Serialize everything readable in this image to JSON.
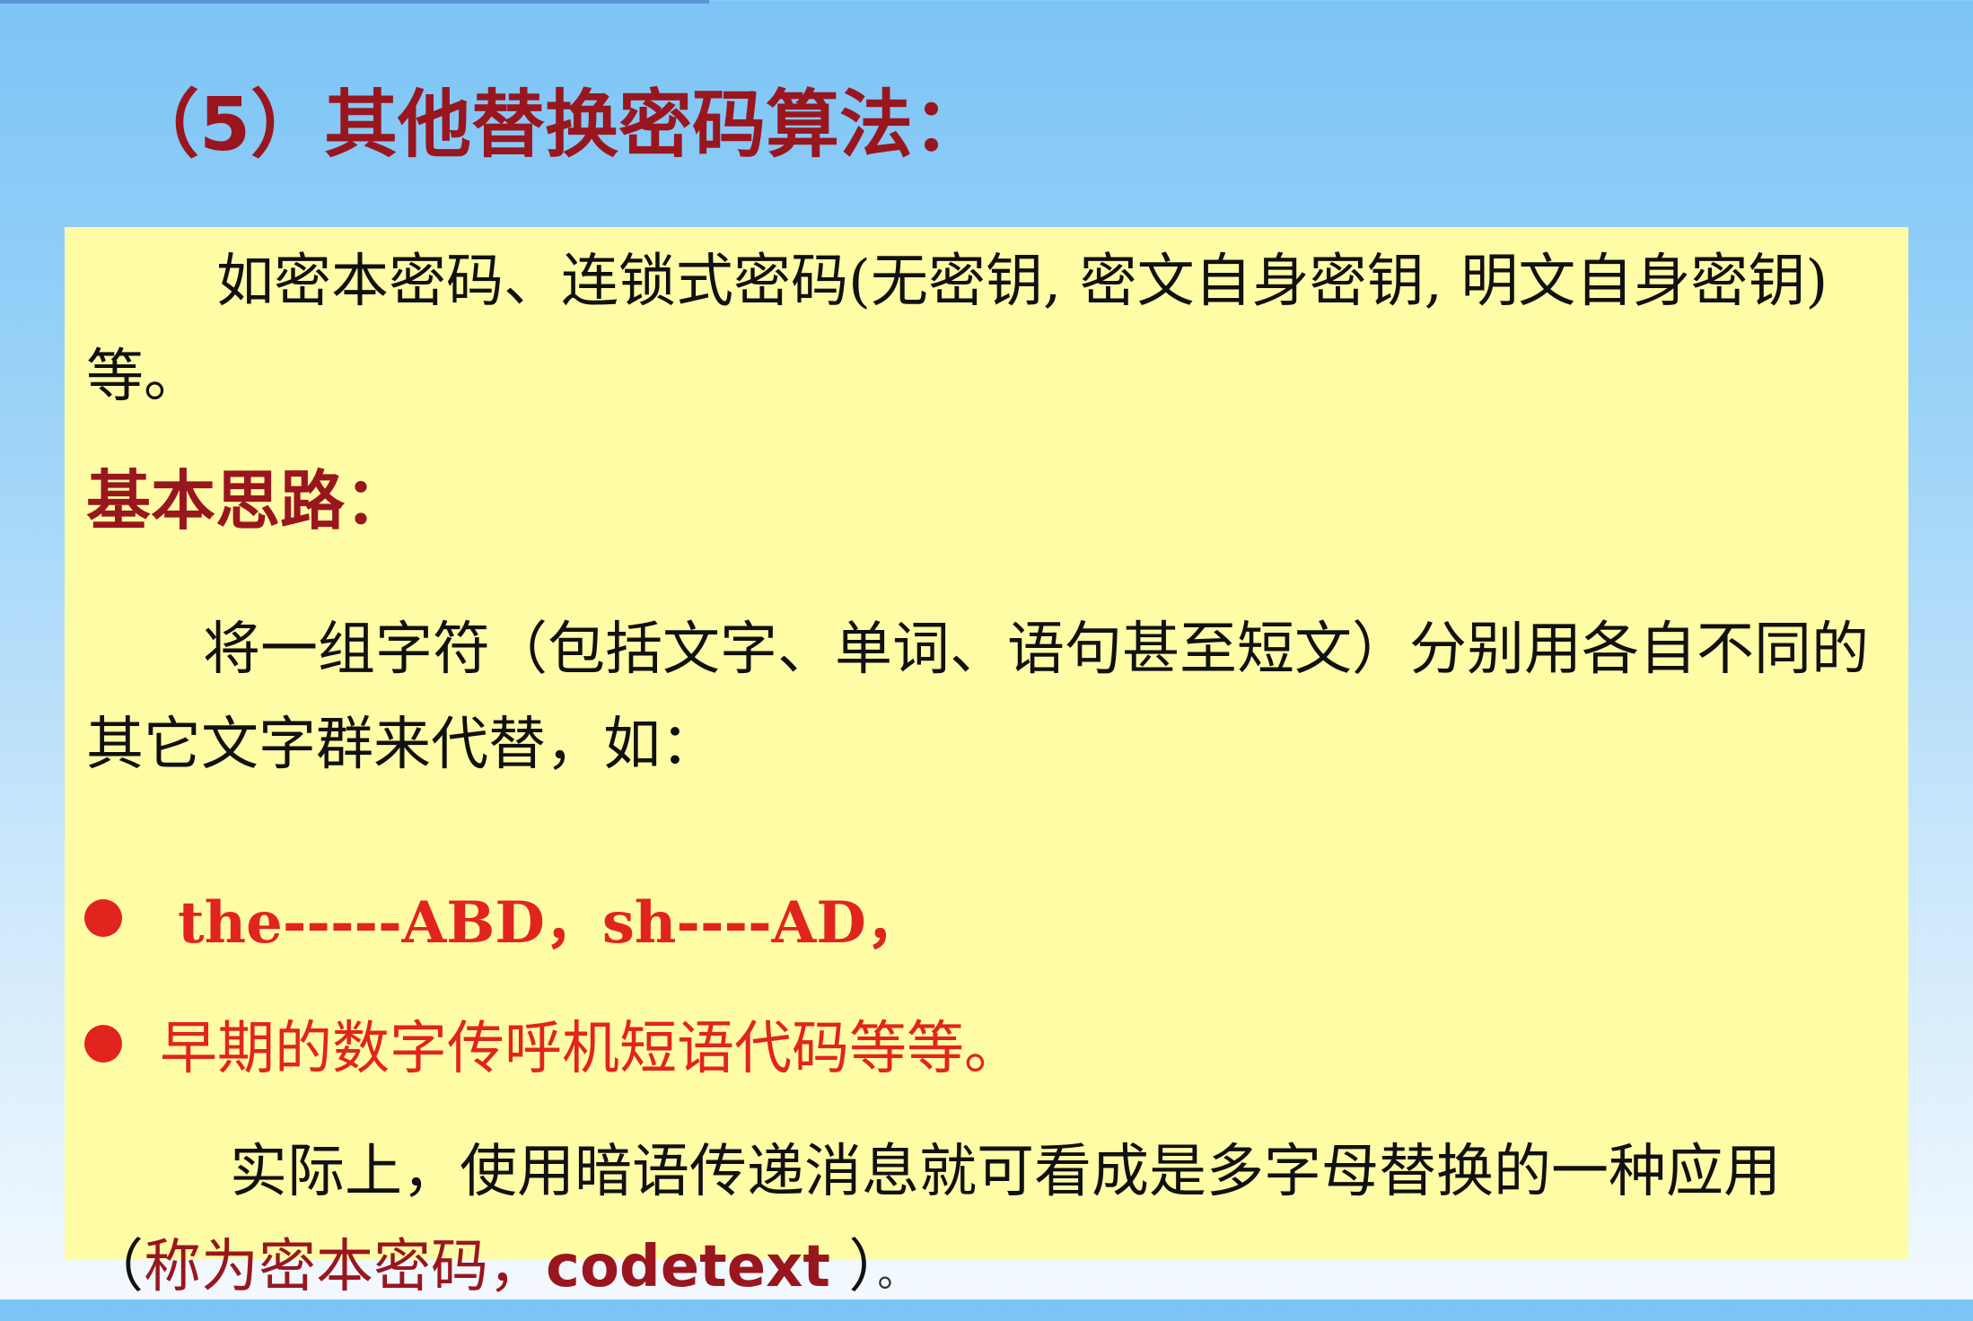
{
  "title": "（5）其他替换密码算法：",
  "intro": "如密本密码、连锁式密码(无密钥, 密文自身密钥, 明文自身密钥)等。",
  "heading": "基本思路：",
  "idea": "将一组字符（包括文字、单词、语句甚至短文）分别用各自不同的其它文字群来代替，如：",
  "bullets": [
    "the-----ABD，sh----AD，",
    "早期的数字传呼机短语代码等等。"
  ],
  "closing": {
    "text": "实际上，使用暗语传递消息就可看成是多字母替换的一种应用（",
    "highlight": "称为密本密码，",
    "code": "codetext",
    "close": " ）",
    "period": "。"
  },
  "colors": {
    "title": "#99161f",
    "bullet": "#e1241e",
    "box": "#fffca6",
    "background_top": "#7cc4f6",
    "background_bottom": "#f3f9fe"
  }
}
